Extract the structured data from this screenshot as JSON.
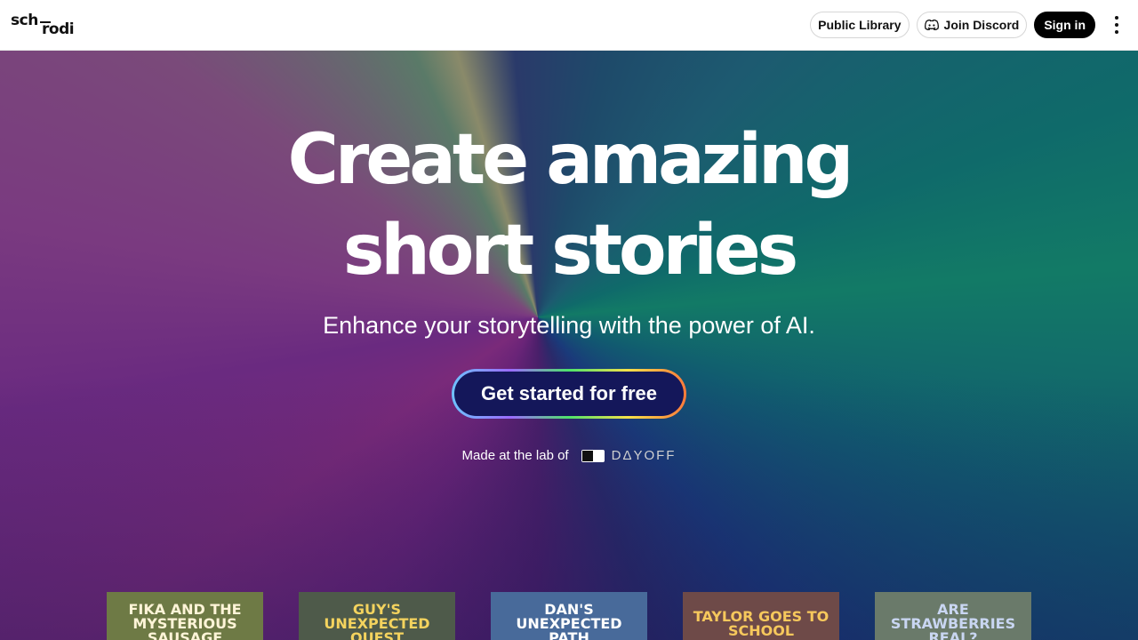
{
  "header": {
    "logo_line1": "sch",
    "logo_line2": "rodi",
    "nav": {
      "public_library": "Public Library",
      "join_discord": "Join Discord",
      "sign_in": "Sign in"
    }
  },
  "hero": {
    "headline_line1": "Create amazing",
    "headline_line2": "short stories",
    "subhead": "Enhance your storytelling with the power of AI.",
    "cta": "Get started for free",
    "made_by": "Made at the lab of",
    "brand": "DΔYOFF"
  },
  "stories": [
    {
      "title": "FIKA AND THE MYSTERIOUS SAUSAGE",
      "bg": "#6e7a45",
      "fg": "#fff5d8"
    },
    {
      "title": "GUY'S UNEXPECTED QUEST",
      "bg": "#4e5a4a",
      "fg": "#f4d35e"
    },
    {
      "title": "DAN'S UNEXPECTED PATH",
      "bg": "#486a9a",
      "fg": "#ffffff"
    },
    {
      "title": "TAYLOR GOES TO SCHOOL",
      "bg": "#6e4a48",
      "fg": "#f6c85c"
    },
    {
      "title": "ARE STRAWBERRIES REAL?",
      "bg": "#6a7a6a",
      "fg": "#c9d6f2"
    }
  ]
}
